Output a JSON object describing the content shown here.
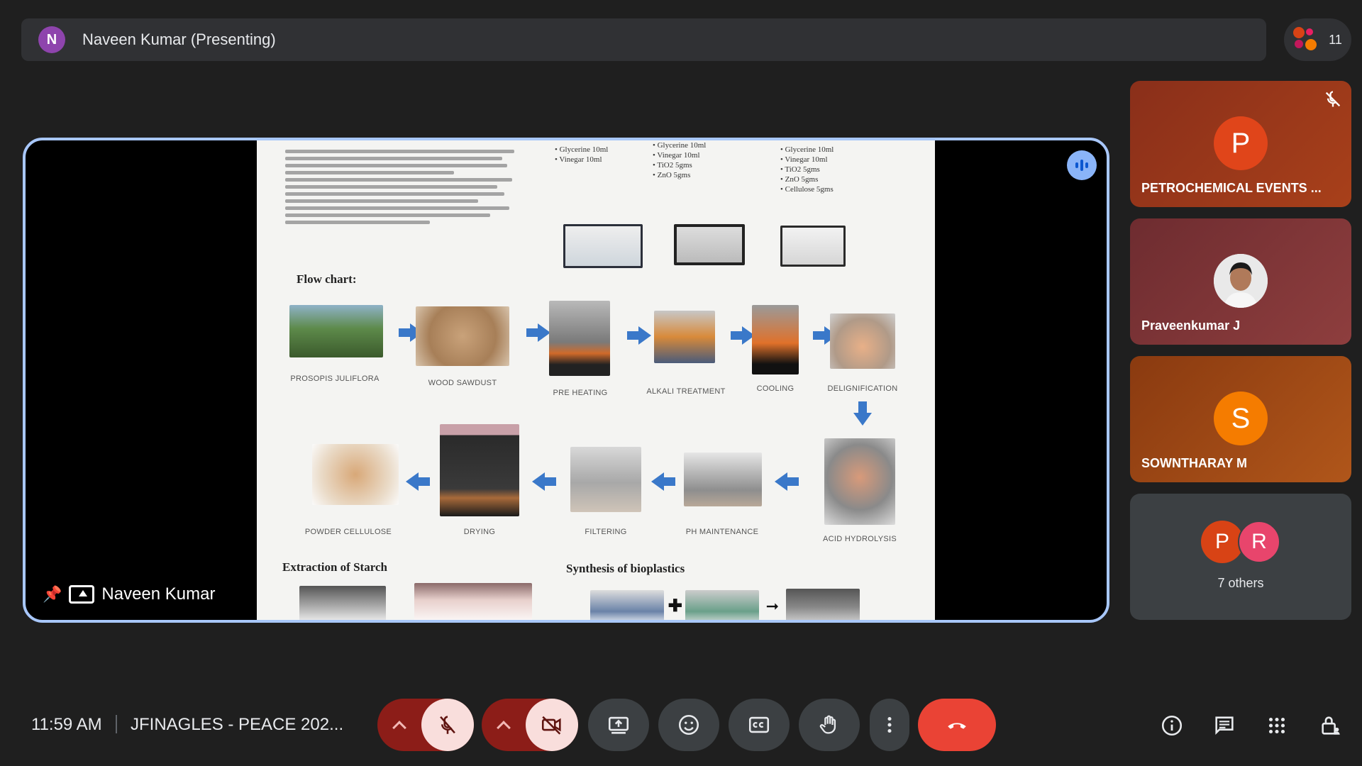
{
  "presenting_bar": {
    "avatar_letter": "N",
    "title": "Naveen Kumar (Presenting)"
  },
  "people": {
    "count": "11"
  },
  "stage": {
    "presenter_name": "Naveen Kumar"
  },
  "slide": {
    "flow_chart_heading": "Flow chart:",
    "top_row": [
      "PROSOPIS JULIFLORA",
      "WOOD SAWDUST",
      "PRE HEATING",
      "ALKALI TREATMENT",
      "COOLING",
      "DELIGNIFICATION"
    ],
    "bottom_row": [
      "POWDER CELLULOSE",
      "DRYING",
      "FILTERING",
      "PH MAINTENANCE",
      "ACID HYDROLYSIS"
    ],
    "section_left": "Extraction of Starch",
    "section_right": "Synthesis of bioplastics",
    "recipes": [
      [
        "Glycerine 10ml",
        "Vinegar 10ml"
      ],
      [
        "Glycerine 10ml",
        "Vinegar 10ml",
        "TiO2 5gms",
        "ZnO 5gms"
      ],
      [
        "Glycerine 10ml",
        "Vinegar 10ml",
        "TiO2 5gms",
        "ZnO 5gms",
        "Cellulose 5gms"
      ]
    ]
  },
  "participants": [
    {
      "letter": "P",
      "name": "PETROCHEMICAL EVENTS ...",
      "bg": "#8a2f1a",
      "avatar_bg": "#d84315"
    },
    {
      "letter": "",
      "name": "Praveenkumar J",
      "bg": "#7a3236",
      "avatar_bg": "#f1f1f1"
    },
    {
      "letter": "S",
      "name": "SOWNTHARAY M",
      "bg": "#9a4a10",
      "avatar_bg": "#ef6c00"
    },
    {
      "others_letters": [
        "P",
        "R"
      ],
      "name": "7 others",
      "bg": "#3c4043"
    }
  ],
  "bottom_bar": {
    "time": "11:59 AM",
    "meeting_name": "JFINAGLES - PEACE 202..."
  },
  "colors": {
    "end_call": "#ea4335",
    "stage_border": "#a8c7fa",
    "mic_group": "#8c1d18"
  }
}
